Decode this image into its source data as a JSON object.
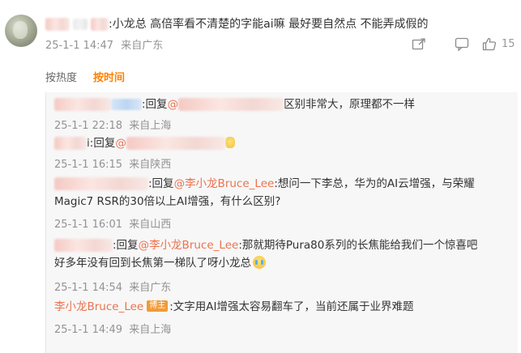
{
  "comment": {
    "body": ":小龙总  高倍率看不清楚的字能ai嘛  最好要自然点  不能弄成假的",
    "time": "25-1-1 14:47",
    "location": "来自广东",
    "like_count": "15"
  },
  "sort": {
    "by_heat": "按热度",
    "by_time": "按时间"
  },
  "replies": [
    {
      "text_prefix": ":回复",
      "mention": "@",
      "text_suffix": "区别非常大，原理都不一样",
      "time": "25-1-1 22:18",
      "location": "来自上海"
    },
    {
      "name_fragment": "i",
      "text_prefix": ":回复",
      "mention": "@",
      "time": "25-1-1 16:15",
      "location": "来自陕西"
    },
    {
      "text_prefix": ":回复",
      "mention": "@李小龙Bruce_Lee",
      "line1_suffix": ":想问一下李总，华为的AI云增强，与荣耀",
      "line2": "Magic7 RSR的30倍以上AI增强，有什么区别?",
      "time": "25-1-1 16:01",
      "location": "来自山西"
    },
    {
      "text_prefix": ":回复",
      "mention": "@李小龙Bruce_Lee",
      "line1_suffix": ":那就期待Pura80系列的长焦能给我们一个惊喜吧",
      "line2": "好多年没有回到长焦第一梯队了呀小龙总",
      "time": "25-1-1 14:54",
      "location": "来自广东"
    },
    {
      "author": "李小龙Bruce_Lee",
      "badge": "博主",
      "text": ":文字用AI增强太容易翻车了，当前还属于业界难题",
      "time": "25-1-1 14:49",
      "location": "来自上海"
    }
  ],
  "colors": {
    "accent_orange": "#ff8200",
    "link": "#eb7350",
    "meta_gray": "#939393",
    "reply_bg": "#f7f7f7"
  },
  "icons": [
    "share-icon",
    "comment-icon",
    "like-icon"
  ]
}
